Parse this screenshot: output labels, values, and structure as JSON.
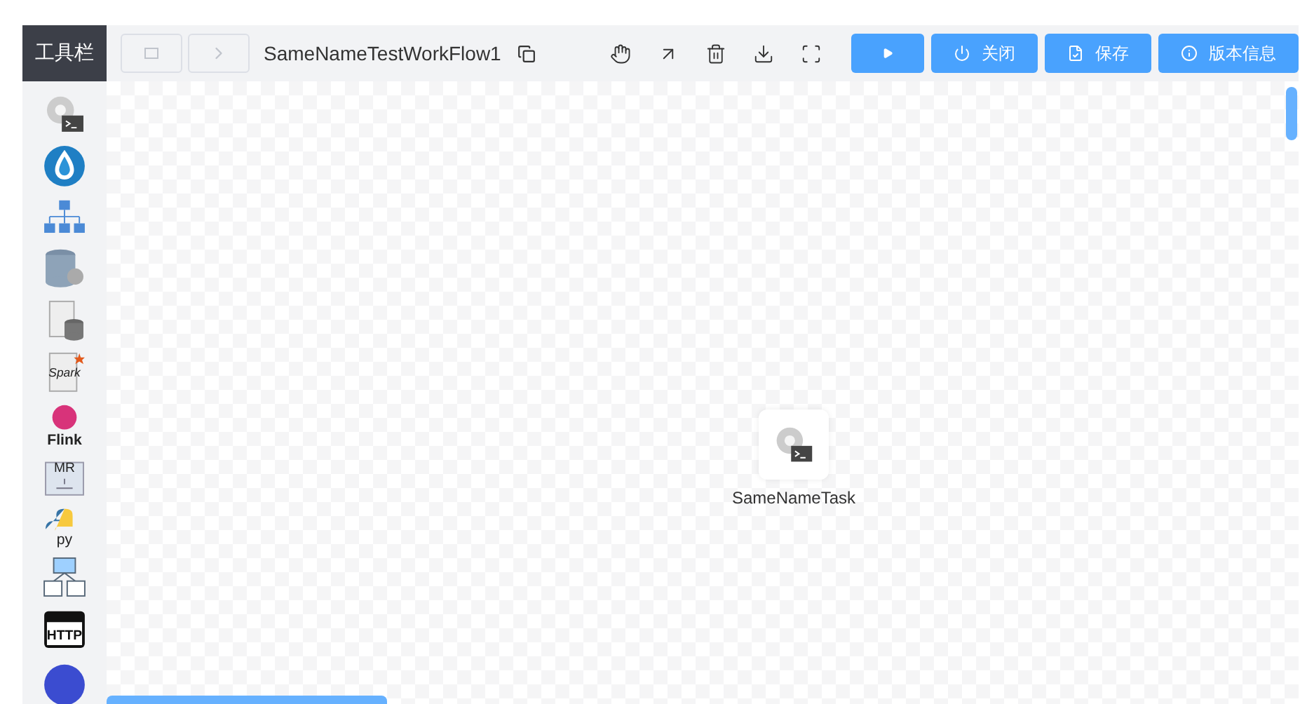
{
  "toolbar": {
    "title": "工具栏"
  },
  "header": {
    "workflow_name": "SameNameTestWorkFlow1",
    "tools": [
      {
        "kind": "drag"
      },
      {
        "kind": "connect"
      },
      {
        "kind": "delete"
      },
      {
        "kind": "download"
      },
      {
        "kind": "fullscreen"
      }
    ],
    "buttons": [
      {
        "kind": "run"
      },
      {
        "kind": "close",
        "label": "关闭"
      },
      {
        "kind": "save",
        "label": "保存"
      },
      {
        "kind": "info",
        "label": "版本信息"
      }
    ]
  },
  "task_types": [
    {
      "kind": "shell"
    },
    {
      "kind": "drop"
    },
    {
      "kind": "tree"
    },
    {
      "kind": "sql"
    },
    {
      "kind": "procedure"
    },
    {
      "kind": "spark",
      "label": "Spark"
    },
    {
      "kind": "flink",
      "label": "Flink"
    },
    {
      "kind": "mr",
      "label": "MR"
    },
    {
      "kind": "python",
      "label": "py"
    },
    {
      "kind": "dependent"
    },
    {
      "kind": "http",
      "label": "HTTP"
    },
    {
      "kind": "circle"
    }
  ],
  "canvas": {
    "nodes": [
      {
        "kind": "shell",
        "label": "SameNameTask"
      }
    ]
  }
}
